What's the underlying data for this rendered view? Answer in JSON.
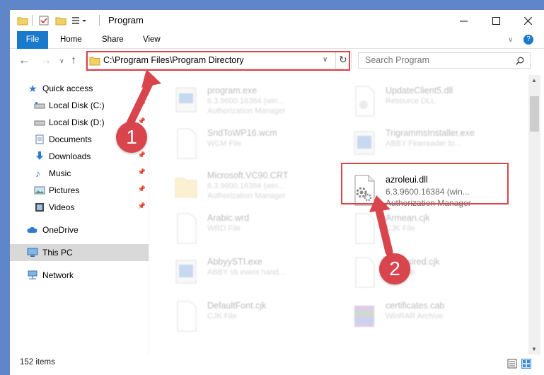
{
  "window": {
    "title": "Program"
  },
  "ribbon": {
    "tabs": [
      "File",
      "Home",
      "Share",
      "View"
    ],
    "help": "?"
  },
  "nav": {
    "address": "C:\\Program Files\\Program Directory",
    "search_placeholder": "Search Program"
  },
  "sidebar": {
    "items": [
      {
        "label": "Quick access"
      },
      {
        "label": "Local Disk (C:)"
      },
      {
        "label": "Local Disk (D:)"
      },
      {
        "label": "Documents"
      },
      {
        "label": "Downloads"
      },
      {
        "label": "Music"
      },
      {
        "label": "Pictures"
      },
      {
        "label": "Videos"
      },
      {
        "label": "OneDrive"
      },
      {
        "label": "This PC"
      },
      {
        "label": "Network"
      }
    ]
  },
  "files": [
    {
      "name": "program.exe",
      "line1": "6.3.9600.16384 (win...",
      "line2": "Authorization Manager"
    },
    {
      "name": "UpdateClient5.dll",
      "line1": "Resource DLL",
      "line2": ""
    },
    {
      "name": "SndToWP16.wcm",
      "line1": "WCM File",
      "line2": ""
    },
    {
      "name": "TrigrammsInstaller.exe",
      "line1": "ABBY Finereader to...",
      "line2": ""
    },
    {
      "name": "Microsoft.VC90.CRT",
      "line1": "6.3.9600.16384 (win...",
      "line2": "Authorization Manager"
    },
    {
      "name": "azroleui.dll",
      "line1": "6.3.9600.16384 (win...",
      "line2": "Authorization Manager"
    },
    {
      "name": "Arabic.wrd",
      "line1": "WRD File",
      "line2": ""
    },
    {
      "name": "Armean.cjk",
      "line1": "CJK File",
      "line2": ""
    },
    {
      "name": "AbbyySTI.exe",
      "line1": "ABBY sti event hand...",
      "line2": ""
    },
    {
      "name": "FarEtsired.cjk",
      "line1": "CJK File",
      "line2": ""
    },
    {
      "name": "DefaultFont.cjk",
      "line1": "CJK File",
      "line2": ""
    },
    {
      "name": "certificates.cab",
      "line1": "WinRAR Archive",
      "line2": ""
    }
  ],
  "status": {
    "items": "152 items"
  },
  "annotations": {
    "one": "1",
    "two": "2"
  },
  "colors": {
    "accent": "#1979ca",
    "highlight": "#d9454d"
  }
}
